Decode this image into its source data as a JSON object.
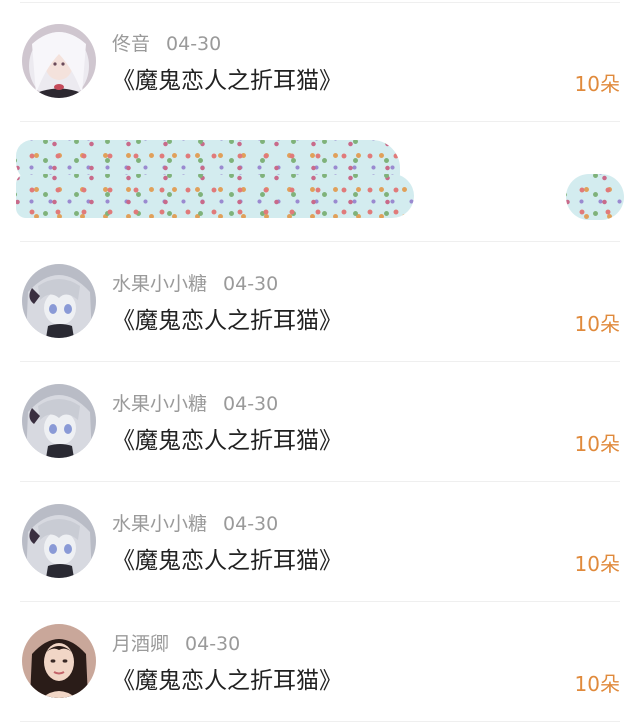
{
  "records": [
    {
      "user": "佟音",
      "date": "04-30",
      "gift": "《魔鬼恋人之折耳猫》",
      "amount": "10朵",
      "avatar": "avatar-white-hair-girl"
    },
    {
      "user": "",
      "date": "",
      "gift": "",
      "amount": "",
      "redacted": true
    },
    {
      "user": "水果小小糖",
      "date": "04-30",
      "gift": "《魔鬼恋人之折耳猫》",
      "amount": "10朵",
      "avatar": "avatar-anime-grey-hair"
    },
    {
      "user": "水果小小糖",
      "date": "04-30",
      "gift": "《魔鬼恋人之折耳猫》",
      "amount": "10朵",
      "avatar": "avatar-anime-grey-hair"
    },
    {
      "user": "水果小小糖",
      "date": "04-30",
      "gift": "《魔鬼恋人之折耳猫》",
      "amount": "10朵",
      "avatar": "avatar-anime-grey-hair"
    },
    {
      "user": "月酒卿",
      "date": "04-30",
      "gift": "《魔鬼恋人之折耳猫》",
      "amount": "10朵",
      "avatar": "avatar-photo-woman"
    }
  ],
  "colors": {
    "amount": "#e08a3c",
    "username": "#9a9a9a",
    "gift_text": "#222222",
    "divider": "#efefef"
  }
}
